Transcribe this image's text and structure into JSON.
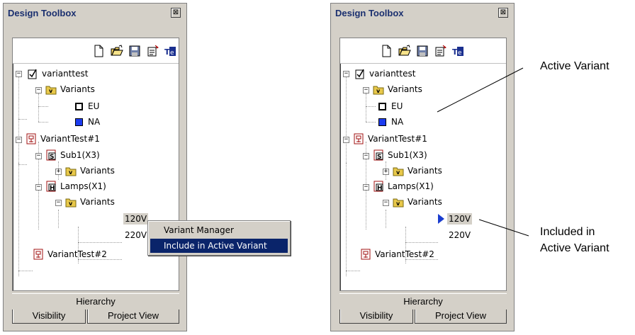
{
  "left_panel": {
    "title": "Design Toolbox",
    "close_glyph": "⊠",
    "toolbar": [
      "new-doc-icon",
      "open-folder-icon",
      "save-disk-icon",
      "properties-icon",
      "text-editor-icon"
    ],
    "tree": {
      "root": "varianttest",
      "variants_folder": "Variants",
      "variant_eu": "EU",
      "variant_na": "NA",
      "test1": "VariantTest#1",
      "sub1": "Sub1(X3)",
      "sub1_variants": "Variants",
      "lamps": "Lamps(X1)",
      "lamps_variants": "Variants",
      "v120": "120V",
      "v220": "220V",
      "test2": "VariantTest#2"
    },
    "context_menu": {
      "item1": "Variant Manager",
      "item2": "Include in Active Variant"
    },
    "footer": "Hierarchy",
    "tabs": [
      "Visibility",
      "Project View"
    ]
  },
  "right_panel": {
    "title": "Design Toolbox",
    "close_glyph": "⊠",
    "tree": {
      "root": "varianttest",
      "variants_folder": "Variants",
      "variant_eu": "EU",
      "variant_na": "NA",
      "test1": "VariantTest#1",
      "sub1": "Sub1(X3)",
      "sub1_variants": "Variants",
      "lamps": "Lamps(X1)",
      "lamps_variants": "Variants",
      "v120": "120V",
      "v220": "220V",
      "test2": "VariantTest#2"
    },
    "footer": "Hierarchy",
    "tabs": [
      "Visibility",
      "Project View"
    ]
  },
  "annotations": {
    "active_variant": "Active Variant",
    "included_line1": "Included in",
    "included_line2": "Active Variant"
  },
  "colors": {
    "active_variant_swatch": "#1c3cf0",
    "menu_highlight": "#0a246a",
    "title_text": "#1a2f6f"
  }
}
